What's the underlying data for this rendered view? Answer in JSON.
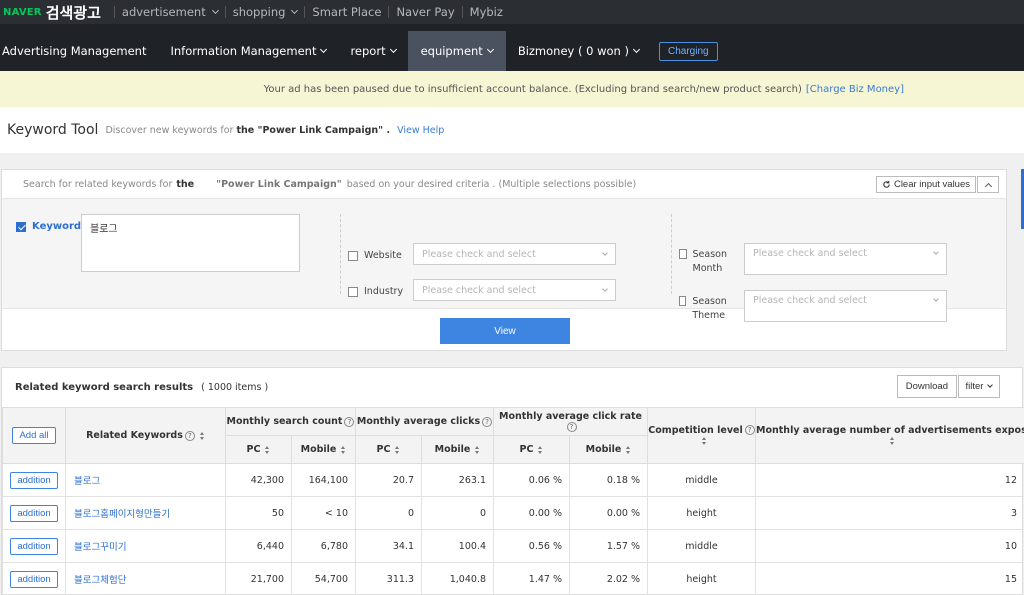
{
  "topbar": {
    "brand_naver": "NAVER",
    "brand_ads": "검색광고",
    "items": [
      {
        "label": "advertisement",
        "dropdown": true
      },
      {
        "label": "shopping",
        "dropdown": true
      },
      {
        "label": "Smart Place",
        "dropdown": false
      },
      {
        "label": "Naver Pay",
        "dropdown": false
      },
      {
        "label": "Mybiz",
        "dropdown": false
      }
    ]
  },
  "mainnav": {
    "items": [
      {
        "label": "Advertising Management"
      },
      {
        "label": "Information Management"
      },
      {
        "label": "report"
      },
      {
        "label": "equipment"
      },
      {
        "label": "Bizmoney ( 0 won )"
      }
    ],
    "charging": "Charging"
  },
  "notice": {
    "text": "Your ad has been paused due to insufficient account balance. (Excluding brand search/new product search)",
    "link": "[Charge Biz Money]"
  },
  "keyword_tool": {
    "title": "Keyword Tool",
    "desc_pre": "Discover new keywords for",
    "desc_bold": "the \"Power Link Campaign\" .",
    "help": "View Help"
  },
  "search_panel": {
    "head_pre": "Search for related keywords for",
    "head_bold": "the",
    "campaign": "\"Power Link Campaign\"",
    "head_post": "based on your desired criteria . (Multiple selections possible)",
    "clear_label": "Clear input values",
    "keyword_label": "Keyword",
    "keyword_value": "블로그",
    "website_label": "Website",
    "industry_label": "Industry",
    "season_month_label": "Season Month",
    "season_theme_label": "Season Theme",
    "select_placeholder": "Please check and select",
    "view_label": "View"
  },
  "results": {
    "title": "Related keyword search results",
    "count": "( 1000 items )",
    "download": "Download",
    "filter": "filter",
    "headers": {
      "add_all": "Add all",
      "related_keywords": "Related Keywords",
      "monthly_search": "Monthly search count",
      "monthly_clicks": "Monthly average clicks",
      "monthly_ctr": "Monthly average click rate",
      "competition": "Competition level",
      "ads_exposed": "Monthly average number of advertisements exposed",
      "pc": "PC",
      "mobile": "Mobile"
    },
    "add_label": "addition",
    "rows": [
      {
        "keyword": "블로그",
        "pc_search": "42,300",
        "mobile_search": "164,100",
        "pc_clicks": "20.7",
        "mobile_clicks": "263.1",
        "pc_ctr": "0.06 %",
        "mobile_ctr": "0.18 %",
        "competition": "middle",
        "ads": "12"
      },
      {
        "keyword": "블로그홈페이지형만들기",
        "pc_search": "50",
        "mobile_search": "< 10",
        "pc_clicks": "0",
        "mobile_clicks": "0",
        "pc_ctr": "0.00 %",
        "mobile_ctr": "0.00 %",
        "competition": "height",
        "ads": "3"
      },
      {
        "keyword": "블로그꾸미기",
        "pc_search": "6,440",
        "mobile_search": "6,780",
        "pc_clicks": "34.1",
        "mobile_clicks": "100.4",
        "pc_ctr": "0.56 %",
        "mobile_ctr": "1.57 %",
        "competition": "middle",
        "ads": "10"
      },
      {
        "keyword": "블로그체험단",
        "pc_search": "21,700",
        "mobile_search": "54,700",
        "pc_clicks": "311.3",
        "mobile_clicks": "1,040.8",
        "pc_ctr": "1.47 %",
        "mobile_ctr": "2.02 %",
        "competition": "height",
        "ads": "15"
      }
    ]
  }
}
